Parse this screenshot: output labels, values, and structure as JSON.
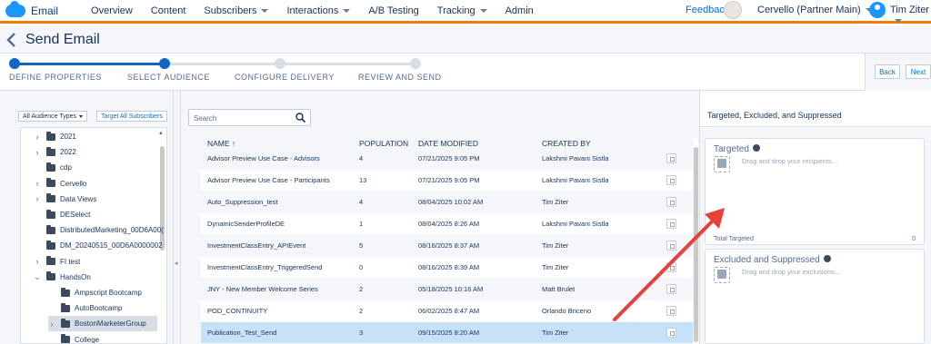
{
  "app": {
    "brand": "Email"
  },
  "nav": {
    "items": [
      {
        "label": "Overview",
        "dropdown": false
      },
      {
        "label": "Content",
        "dropdown": false
      },
      {
        "label": "Subscribers",
        "dropdown": true
      },
      {
        "label": "Interactions",
        "dropdown": true
      },
      {
        "label": "A/B Testing",
        "dropdown": false
      },
      {
        "label": "Tracking",
        "dropdown": true
      },
      {
        "label": "Admin",
        "dropdown": false
      }
    ],
    "feedback": "Feedback",
    "account": "Cervello (Partner Main)",
    "user": "Tim Ziter"
  },
  "page": {
    "title": "Send Email"
  },
  "progress": {
    "steps": [
      "DEFINE PROPERTIES",
      "SELECT AUDIENCE",
      "CONFIGURE DELIVERY",
      "REVIEW AND SEND"
    ],
    "current_step": 2,
    "back": "Back",
    "next": "Next"
  },
  "audience": {
    "type_select": "All Audience Types",
    "target_all": "Target All Subscribers"
  },
  "tree": [
    {
      "label": "2021",
      "expand": "right",
      "level": 0
    },
    {
      "label": "2022",
      "expand": "right",
      "level": 0
    },
    {
      "label": "cdp",
      "expand": "",
      "level": 0
    },
    {
      "label": "Cervello",
      "expand": "right",
      "level": 0
    },
    {
      "label": "Data Views",
      "expand": "right",
      "level": 0
    },
    {
      "label": "DESelect",
      "expand": "",
      "level": 0
    },
    {
      "label": "DistributedMarketing_00D6A00(",
      "expand": "",
      "level": 0
    },
    {
      "label": "DM_20240515_00D6A0000002",
      "expand": "",
      "level": 0
    },
    {
      "label": "FI test",
      "expand": "right",
      "level": 0
    },
    {
      "label": "HandsOn",
      "expand": "down",
      "level": 0
    },
    {
      "label": "Ampscript Bootcamp",
      "expand": "",
      "level": 1
    },
    {
      "label": "AutoBootcamp",
      "expand": "",
      "level": 1
    },
    {
      "label": "BostonMarketerGroup",
      "expand": "right",
      "level": 1,
      "selected": true
    },
    {
      "label": "College",
      "expand": "",
      "level": 1
    }
  ],
  "search": {
    "placeholder": "Search"
  },
  "table": {
    "headers": [
      "NAME ↑",
      "POPULATION",
      "DATE MODIFIED",
      "CREATED BY"
    ],
    "rows": [
      [
        "Advisor Preview Use Case - Advisors",
        "4",
        "07/21/2025 9:05 PM",
        "Lakshmi Pavani Sistla"
      ],
      [
        "Advisor Preview Use Case - Participants",
        "13",
        "07/21/2025 9:05 PM",
        "Lakshmi Pavani Sistla"
      ],
      [
        "Auto_Suppression_test",
        "4",
        "08/04/2025 10:02 AM",
        "Tim Ziter"
      ],
      [
        "DynamicSenderProfileDE",
        "1",
        "08/04/2025 8:26 AM",
        "Lakshmi Pavani Sistla"
      ],
      [
        "InvestmentClassEntry_APIEvent",
        "5",
        "08/16/2025 8:37 AM",
        "Tim Ziter"
      ],
      [
        "InvestmentClassEntry_TriggeredSend",
        "0",
        "08/16/2025 8:39 AM",
        "Tim Ziter"
      ],
      [
        "JNY - New Member Welcome Series",
        "2",
        "05/18/2025 10:16 AM",
        "Matt Brulet"
      ],
      [
        "POD_CONTINUITY",
        "2",
        "06/02/2025 8:47 AM",
        "Orlando Briceno"
      ],
      [
        "Publication_Test_Send",
        "3",
        "09/15/2025 8:20 AM",
        "Tim Ziter"
      ]
    ],
    "selected_row": 8
  },
  "right": {
    "title": "Targeted, Excluded, and Suppressed",
    "targeted": {
      "title": "Targeted",
      "drop_hint": "Drag and drop your recipients...",
      "total_label": "Total Targeted",
      "total_value": "0"
    },
    "excluded": {
      "title": "Excluded and Suppressed",
      "drop_hint": "Drag and drop your exclusions..."
    }
  },
  "colors": {
    "accent": "#1166c4",
    "nav_border": "#f07c12",
    "annotation_arrow": "#e8413c",
    "selected_row": "#c5e2f7"
  }
}
